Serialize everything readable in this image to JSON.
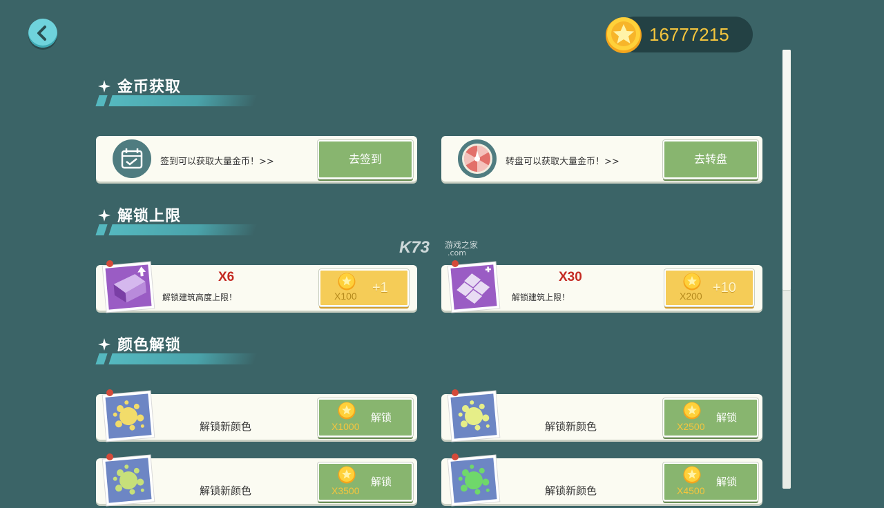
{
  "header": {
    "coins": "16777215"
  },
  "sections": {
    "earn": "金币获取",
    "unlock_limit": "解锁上限",
    "color_unlock": "颜色解锁"
  },
  "earn_cards": [
    {
      "desc": "签到可以获取大量金币！>>",
      "button": "去签到",
      "icon": "calendar-check-icon"
    },
    {
      "desc": "转盘可以获取大量金币！>>",
      "button": "去转盘",
      "icon": "spin-wheel-icon"
    }
  ],
  "limit_cards": [
    {
      "multiplier": "X6",
      "desc": "解锁建筑高度上限！",
      "price": "X100",
      "reward": "+1",
      "icon": "building-height-icon"
    },
    {
      "multiplier": "X30",
      "desc": "解锁建筑上限！",
      "price": "X200",
      "reward": "+10",
      "icon": "building-count-icon"
    }
  ],
  "color_cards": [
    {
      "label": "解锁新颜色",
      "price": "X1000",
      "button": "解锁",
      "paint_color": "#f2dc6a"
    },
    {
      "label": "解锁新颜色",
      "price": "X2500",
      "button": "解锁",
      "paint_color": "#e6ee88"
    },
    {
      "label": "解锁新颜色",
      "price": "X3500",
      "button": "解锁",
      "paint_color": "#c7e07a"
    },
    {
      "label": "解锁新颜色",
      "price": "X4500",
      "button": "解锁",
      "paint_color": "#6fd86a"
    }
  ],
  "watermark": {
    "brand": "K73",
    "text": "游戏之家",
    "domain": ".com"
  },
  "colors": {
    "background": "#3b6467",
    "accent_teal": "#55b8bf",
    "button_green": "#88b56f",
    "button_yellow": "#f5cc57",
    "coin_text": "#f5c53d"
  }
}
